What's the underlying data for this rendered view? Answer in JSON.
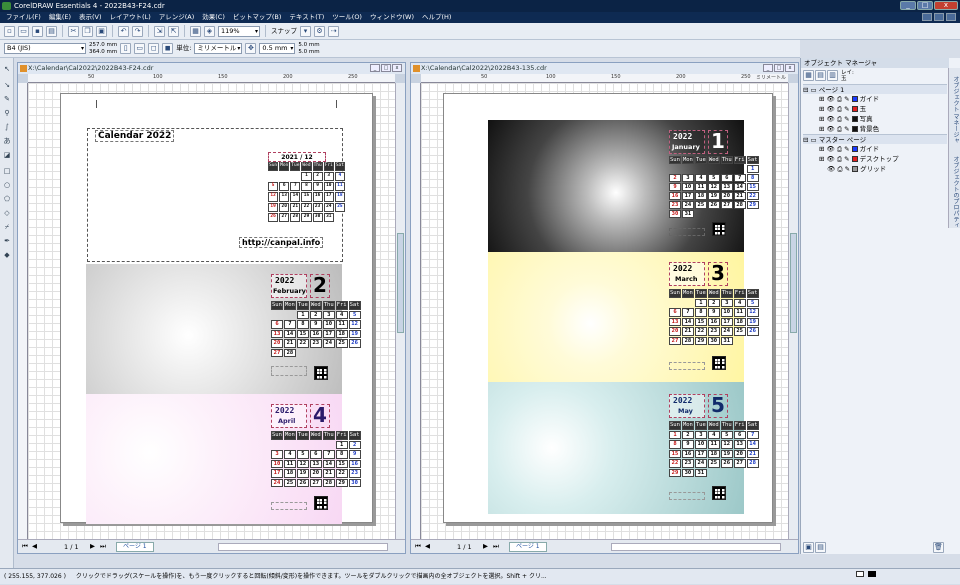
{
  "window": {
    "title": "CorelDRAW Essentials 4 - 2022B43-F24.cdr",
    "min": "_",
    "max": "□",
    "close": "x"
  },
  "menu": [
    "ファイル(F)",
    "編集(E)",
    "表示(V)",
    "レイアウト(L)",
    "アレンジ(A)",
    "効果(C)",
    "ビットマップ(B)",
    "テキスト(T)",
    "ツール(O)",
    "ウィンドウ(W)",
    "ヘルプ(H)"
  ],
  "toolbar": {
    "zoom": "119%",
    "snap": "スナップ"
  },
  "propbar": {
    "paper": "B4 (JIS)",
    "width": "257.0 mm",
    "height": "364.0 mm",
    "unit_label": "単位:",
    "unit": "ミリメートル",
    "nudge": "0.5 mm",
    "dup_x": "5.0 mm",
    "dup_y": "5.0 mm"
  },
  "doc_left": {
    "title": "X:\\Calendar\\Cal2022\\2022B43-F24.cdr",
    "page_count": "1 / 1",
    "page_tab": "ページ 1",
    "ruler": [
      "50",
      "100",
      "150",
      "200",
      "250"
    ],
    "header_title": "Calendar 2022",
    "url": "http://canpal.info",
    "dec": {
      "label": "2021 / 12",
      "cells": [
        "Sun",
        "Mon",
        "Tue",
        "Wed",
        "Thu",
        "Fri",
        "Sat",
        "",
        "",
        "",
        "1",
        "2",
        "3",
        "4",
        "5",
        "6",
        "7",
        "8",
        "9",
        "10",
        "11",
        "12",
        "13",
        "14",
        "15",
        "16",
        "17",
        "18",
        "19",
        "20",
        "21",
        "22",
        "23",
        "24",
        "25",
        "26",
        "27",
        "28",
        "29",
        "30",
        "31",
        ""
      ]
    },
    "feb": {
      "year": "2022",
      "month": "February",
      "num": "2"
    },
    "apr": {
      "year": "2022",
      "month": "April",
      "num": "4"
    }
  },
  "doc_right": {
    "title": "X:\\Calendar\\Cal2022\\2022B43-135.cdr",
    "page_count": "1 / 1",
    "page_tab": "ページ 1",
    "ruler": [
      "50",
      "100",
      "150",
      "200",
      "250",
      "ミリメートル"
    ],
    "jan": {
      "year": "2022",
      "month": "January",
      "num": "1"
    },
    "mar": {
      "year": "2022",
      "month": "March",
      "num": "3"
    },
    "may": {
      "year": "2022",
      "month": "May",
      "num": "5"
    }
  },
  "cells": {
    "jan": [
      "Sun",
      "Mon",
      "Tue",
      "Wed",
      "Thu",
      "Fri",
      "Sat",
      "",
      "",
      "",
      "",
      "",
      "",
      "1",
      "2",
      "3",
      "4",
      "5",
      "6",
      "7",
      "8",
      "9",
      "10",
      "11",
      "12",
      "13",
      "14",
      "15",
      "16",
      "17",
      "18",
      "19",
      "20",
      "21",
      "22",
      "23",
      "24",
      "25",
      "26",
      "27",
      "28",
      "29",
      "30",
      "31"
    ],
    "feb": [
      "Sun",
      "Mon",
      "Tue",
      "Wed",
      "Thu",
      "Fri",
      "Sat",
      "",
      "",
      "1",
      "2",
      "3",
      "4",
      "5",
      "6",
      "7",
      "8",
      "9",
      "10",
      "11",
      "12",
      "13",
      "14",
      "15",
      "16",
      "17",
      "18",
      "19",
      "20",
      "21",
      "22",
      "23",
      "24",
      "25",
      "26",
      "27",
      "28"
    ],
    "mar": [
      "Sun",
      "Mon",
      "Tue",
      "Wed",
      "Thu",
      "Fri",
      "Sat",
      "",
      "",
      "1",
      "2",
      "3",
      "4",
      "5",
      "6",
      "7",
      "8",
      "9",
      "10",
      "11",
      "12",
      "13",
      "14",
      "15",
      "16",
      "17",
      "18",
      "19",
      "20",
      "21",
      "22",
      "23",
      "24",
      "25",
      "26",
      "27",
      "28",
      "29",
      "30",
      "31"
    ],
    "apr": [
      "Sun",
      "Mon",
      "Tue",
      "Wed",
      "Thu",
      "Fri",
      "Sat",
      "",
      "",
      "",
      "",
      "",
      "1",
      "2",
      "3",
      "4",
      "5",
      "6",
      "7",
      "8",
      "9",
      "10",
      "11",
      "12",
      "13",
      "14",
      "15",
      "16",
      "17",
      "18",
      "19",
      "20",
      "21",
      "22",
      "23",
      "24",
      "25",
      "26",
      "27",
      "28",
      "29",
      "30"
    ],
    "may": [
      "Sun",
      "Mon",
      "Tue",
      "Wed",
      "Thu",
      "Fri",
      "Sat",
      "1",
      "2",
      "3",
      "4",
      "5",
      "6",
      "7",
      "8",
      "9",
      "10",
      "11",
      "12",
      "13",
      "14",
      "15",
      "16",
      "17",
      "18",
      "19",
      "20",
      "21",
      "22",
      "23",
      "24",
      "25",
      "26",
      "27",
      "28",
      "29",
      "30",
      "31"
    ]
  },
  "panel": {
    "title": "オブジェクト マネージャ",
    "layer_label": "レイ:",
    "layer_value": "玉",
    "rows": [
      {
        "text": "ページ 1",
        "hdr": true
      },
      {
        "text": "ガイド",
        "color": "#1a3aff"
      },
      {
        "text": "玉",
        "color": "#e02020"
      },
      {
        "text": "写真",
        "color": "#111111"
      },
      {
        "text": "背景色",
        "color": "#111111"
      },
      {
        "text": "マスター ページ",
        "hdr": true
      },
      {
        "text": "ガイド",
        "color": "#1a3aff"
      },
      {
        "text": "デスクトップ",
        "color": "#e02020"
      },
      {
        "text": "グリッド",
        "color": "#999999"
      }
    ],
    "sidetabs": "オブジェクト マネージャ",
    "sidetabs2": "オブジェクトのプロパティ"
  },
  "status": {
    "coords": "( 255.155, 377.026 )",
    "hint": "クリックでドラッグ(スケールを操作)を、もう一度クリックすると回転(傾斜/変形)を操作できます。ツールをダブルクリックで描画内の全オブジェクトを選択。Shift + クリ..."
  }
}
